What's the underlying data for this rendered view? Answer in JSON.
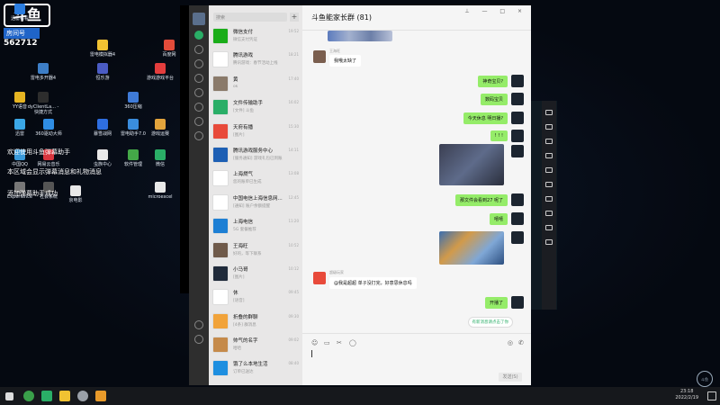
{
  "desktop": {
    "icons": [
      {
        "label": "迅雷看看"
      },
      {
        "label": "雷电模拟器4"
      },
      {
        "label": "百度网"
      },
      {
        "label": "雷电多开器4"
      },
      {
        "label": "恒乐游"
      },
      {
        "label": "游戏游戏平台"
      },
      {
        "label": "YY语音"
      },
      {
        "label": "dyClientLa... - 快捷方式"
      },
      {
        "label": "360压缩"
      },
      {
        "label": "迅雷"
      },
      {
        "label": "360驱动大师"
      },
      {
        "label": "暴雪战网"
      },
      {
        "label": "雷电助手7.0"
      },
      {
        "label": "游戏运赛"
      },
      {
        "label": "中国QQ"
      },
      {
        "label": "网易云音乐"
      },
      {
        "label": "虫族中心"
      },
      {
        "label": "软件管理"
      },
      {
        "label": "微信"
      },
      {
        "label": "Experience"
      },
      {
        "label": "社会系统"
      },
      {
        "label": "京电影"
      },
      {
        "label": "microexcel"
      }
    ],
    "watermark": {
      "logo": "斗鱼",
      "room_label": "房间号",
      "room_number": "562712"
    },
    "overlay": {
      "line1": "欢迎使用斗鱼弹幕助手",
      "line2": "本区域会显示弹幕消息和礼物消息",
      "line3": "添加弹幕助手成功"
    }
  },
  "wechat": {
    "search_placeholder": "搜索",
    "plus": "+",
    "conversations": [
      {
        "name": "微信支付",
        "preview": "微信支付凭证",
        "time": "19:52",
        "color": "#1aad19"
      },
      {
        "name": "腾讯游戏",
        "preview": "腾讯游戏：春节活动上线",
        "time": "18:21",
        "color": "#ffffff"
      },
      {
        "name": "黄",
        "preview": "ok",
        "time": "17:40",
        "color": "#8a7a6a"
      },
      {
        "name": "文件传输助手",
        "preview": "[文件] 斗鱼",
        "time": "16:02",
        "color": "#2aae67"
      },
      {
        "name": "天府有播",
        "preview": "[图片]",
        "time": "15:30",
        "color": "#e84a3a"
      },
      {
        "name": "腾讯游戏服务中心",
        "preview": "[服务通知] 游戏礼包已到账",
        "time": "14:11",
        "color": "#1d5fb4"
      },
      {
        "name": "上海燃气",
        "preview": "您的账单已生成",
        "time": "13:08",
        "color": "#ffffff"
      },
      {
        "name": "中国电信上海信息网...",
        "preview": "[通知] 账户余额提醒",
        "time": "12:45",
        "color": "#ffffff"
      },
      {
        "name": "上海电信",
        "preview": "5G 套餐推荐",
        "time": "11:20",
        "color": "#1d7fd4"
      },
      {
        "name": "王海旺",
        "preview": "好的，等下联系",
        "time": "10:52",
        "color": "#6f5a4a"
      },
      {
        "name": "小马哥",
        "preview": "[图片]",
        "time": "10:12",
        "color": "#1f2a3a"
      },
      {
        "name": "休",
        "preview": "[语音]",
        "time": "09:45",
        "color": "#ffffff"
      },
      {
        "name": "折叠的群聊",
        "preview": "[4条] 群消息",
        "time": "09:30",
        "color": "#f1a33a"
      },
      {
        "name": "帅气的名字",
        "preview": "哈哈",
        "time": "09:02",
        "color": "#c58a4a"
      },
      {
        "name": "饿了么本地生活",
        "preview": "订单已送达",
        "time": "08:40",
        "color": "#1e8fe0"
      }
    ],
    "chat": {
      "title": "斗鱼能家长群 (81)",
      "window_controls": "⊥ — □ ×",
      "messages": [
        {
          "side": "l",
          "sender": "王海旺",
          "text": "我哦太缺了"
        },
        {
          "side": "r",
          "text": "神奇宝贝?"
        },
        {
          "side": "r",
          "text": "数码宝贝"
        },
        {
          "side": "r",
          "text": "今天休息  明日播?"
        },
        {
          "side": "r",
          "text": "! ! !"
        },
        {
          "side": "r",
          "text": "那文件会看到27 呢了"
        },
        {
          "side": "r",
          "text": "嘻嘻"
        },
        {
          "side": "l",
          "sender": "超级玩家",
          "text": "@我是超超 单子没打完，好意思休息吗"
        },
        {
          "side": "r",
          "text": "开播了"
        }
      ],
      "new_message_hint": "有新消息请点击了你",
      "send_label": "发送(S)",
      "toolbar_icons": [
        "☺",
        "▭",
        "✂",
        "◯"
      ]
    }
  },
  "taskbar": {
    "time": "23:18",
    "date": "2022/2/19",
    "watermark_logo": "斗鱼"
  }
}
